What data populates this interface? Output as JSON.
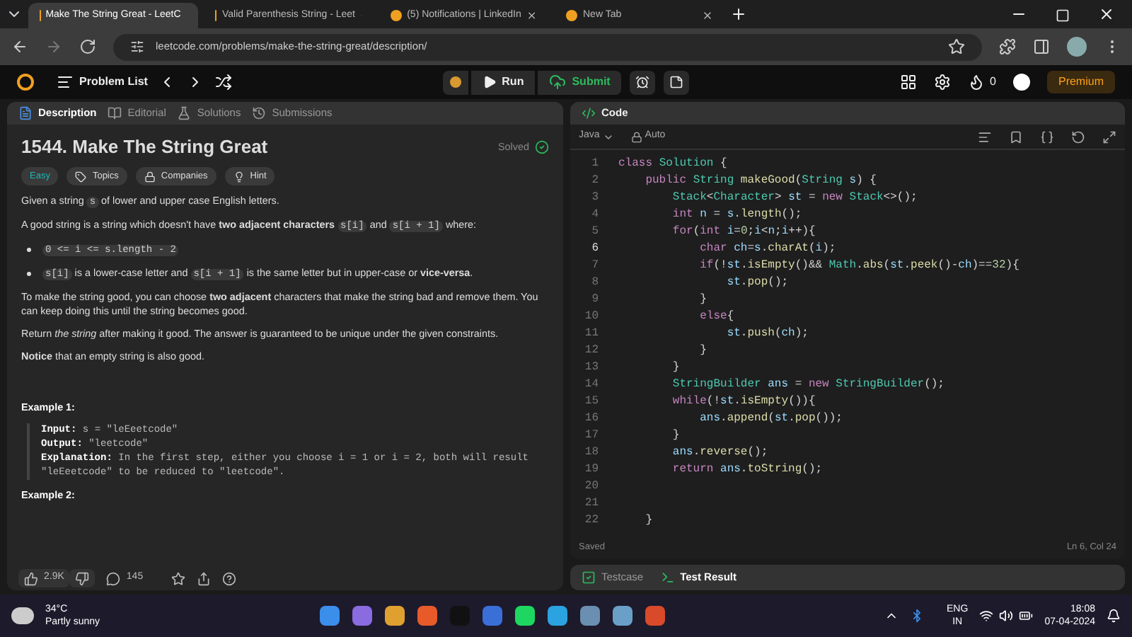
{
  "browser": {
    "tabs": [
      {
        "title": "Make The String Great - LeetC",
        "selected": true
      },
      {
        "title": "Valid Parenthesis String - Leet",
        "selected": false
      },
      {
        "title": "(5) Notifications | LinkedIn",
        "selected": false
      },
      {
        "title": "New Tab",
        "selected": false
      }
    ],
    "url": "leetcode.com/problems/make-the-string-great/description/"
  },
  "header": {
    "problem_list": "Problem List",
    "run": "Run",
    "submit": "Submit",
    "streak": "0",
    "premium": "Premium"
  },
  "left_tabs": [
    {
      "label": "Description",
      "selected": true
    },
    {
      "label": "Editorial",
      "selected": false
    },
    {
      "label": "Solutions",
      "selected": false
    },
    {
      "label": "Submissions",
      "selected": false
    }
  ],
  "problem": {
    "title": "1544. Make The String Great",
    "status": "Solved",
    "tags": [
      {
        "label": "Easy",
        "kind": "difficulty"
      },
      {
        "label": "Topics",
        "kind": "topics"
      },
      {
        "label": "Companies",
        "kind": "companies"
      },
      {
        "label": "Hint",
        "kind": "hint"
      }
    ],
    "blocks": [
      {
        "kind": "paragraph",
        "segments": [
          {
            "kind": "text",
            "text": "Given a string "
          },
          {
            "kind": "code",
            "text": "s"
          },
          {
            "kind": "text",
            "text": " of lower and upper case English letters."
          }
        ]
      },
      {
        "kind": "paragraph",
        "segments": [
          {
            "kind": "text",
            "text": "A good string is a string which doesn't have **two adjacent characters** "
          },
          {
            "kind": "code",
            "text": "s[i]"
          },
          {
            "kind": "text",
            "text": " and "
          },
          {
            "kind": "code",
            "text": "s[i + 1]"
          },
          {
            "kind": "text",
            "text": " where:"
          }
        ]
      },
      {
        "kind": "bullet",
        "segments": [
          {
            "kind": "code",
            "text": "0 <= i <= s.length - 2"
          }
        ]
      },
      {
        "kind": "bullet",
        "segments": [
          {
            "kind": "code",
            "text": "s[i]"
          },
          {
            "kind": "text",
            "text": " is a lower-case letter and "
          },
          {
            "kind": "code",
            "text": "s[i + 1]"
          },
          {
            "kind": "text",
            "text": " is the same letter but in upper-case or **vice-versa**."
          }
        ]
      },
      {
        "kind": "paragraph",
        "segments": [
          {
            "kind": "text",
            "text": "To make the string good, you can choose **two adjacent** characters that make the string bad and remove them. You can keep doing this until the string becomes good."
          }
        ]
      },
      {
        "kind": "paragraph",
        "segments": [
          {
            "kind": "text",
            "text": "Return *the string* after making it good. The answer is guaranteed to be unique under the given constraints."
          }
        ]
      },
      {
        "kind": "paragraph",
        "segments": [
          {
            "kind": "text",
            "text": "**Notice** that an empty string is also good."
          }
        ]
      },
      {
        "kind": "heading",
        "text": "Example 1:"
      },
      {
        "kind": "example",
        "lines": [
          {
            "label": "Input:",
            "text": "s = \"leEeetcode\""
          },
          {
            "label": "Output:",
            "text": "\"leetcode\""
          },
          {
            "label": "Explanation:",
            "text": "In the first step, either you choose i = 1 or i = 2, both will result \"leEeetcode\" to be reduced to \"leetcode\"."
          }
        ]
      },
      {
        "kind": "heading",
        "text": "Example 2:"
      }
    ]
  },
  "footer": {
    "likes": "2.9K",
    "comments": "145"
  },
  "code": {
    "title": "Code",
    "language": "Java",
    "mode": "Auto",
    "status": "Saved",
    "cursor": "Ln 6, Col 24",
    "lines": [
      {
        "number": "1",
        "current": false,
        "tokens": [
          {
            "kind": "kw",
            "text": "class"
          },
          {
            "kind": "type",
            "text": " Solution"
          },
          {
            "kind": "p",
            "text": " {"
          }
        ]
      },
      {
        "number": "2",
        "current": false,
        "tokens": [
          {
            "kind": "kw",
            "text": "    public"
          },
          {
            "kind": "type",
            "text": " String"
          },
          {
            "kind": "fn",
            "text": " makeGood"
          },
          {
            "kind": "p",
            "text": "("
          },
          {
            "kind": "type",
            "text": "String"
          },
          {
            "kind": "var",
            "text": " s"
          },
          {
            "kind": "p",
            "text": ") {"
          }
        ]
      },
      {
        "number": "3",
        "current": false,
        "tokens": [
          {
            "kind": "type",
            "text": "        Stack"
          },
          {
            "kind": "p",
            "text": "<"
          },
          {
            "kind": "type",
            "text": "Character"
          },
          {
            "kind": "p",
            "text": "> "
          },
          {
            "kind": "var",
            "text": "st"
          },
          {
            "kind": "p",
            "text": " = "
          },
          {
            "kind": "kw",
            "text": "new"
          },
          {
            "kind": "type",
            "text": " Stack"
          },
          {
            "kind": "p",
            "text": "<>();"
          }
        ]
      },
      {
        "number": "4",
        "current": false,
        "tokens": [
          {
            "kind": "kw",
            "text": "        int"
          },
          {
            "kind": "var",
            "text": " n"
          },
          {
            "kind": "p",
            "text": " = "
          },
          {
            "kind": "var",
            "text": "s"
          },
          {
            "kind": "p",
            "text": "."
          },
          {
            "kind": "fn",
            "text": "length"
          },
          {
            "kind": "p",
            "text": "();"
          }
        ]
      },
      {
        "number": "5",
        "current": false,
        "tokens": [
          {
            "kind": "kw",
            "text": "        for"
          },
          {
            "kind": "p",
            "text": "("
          },
          {
            "kind": "kw",
            "text": "int"
          },
          {
            "kind": "var",
            "text": " i"
          },
          {
            "kind": "p",
            "text": "="
          },
          {
            "kind": "num",
            "text": "0"
          },
          {
            "kind": "p",
            "text": ";"
          },
          {
            "kind": "var",
            "text": "i"
          },
          {
            "kind": "p",
            "text": "<"
          },
          {
            "kind": "var",
            "text": "n"
          },
          {
            "kind": "p",
            "text": ";"
          },
          {
            "kind": "var",
            "text": "i"
          },
          {
            "kind": "p",
            "text": "++){"
          }
        ]
      },
      {
        "number": "6",
        "current": true,
        "tokens": [
          {
            "kind": "kw",
            "text": "            char"
          },
          {
            "kind": "var",
            "text": " ch"
          },
          {
            "kind": "p",
            "text": "="
          },
          {
            "kind": "var",
            "text": "s"
          },
          {
            "kind": "p",
            "text": "."
          },
          {
            "kind": "fn",
            "text": "charAt"
          },
          {
            "kind": "p",
            "text": "("
          },
          {
            "kind": "var",
            "text": "i"
          },
          {
            "kind": "p",
            "text": ");"
          }
        ]
      },
      {
        "number": "7",
        "current": false,
        "tokens": [
          {
            "kind": "kw",
            "text": "            if"
          },
          {
            "kind": "p",
            "text": "(!"
          },
          {
            "kind": "var",
            "text": "st"
          },
          {
            "kind": "p",
            "text": "."
          },
          {
            "kind": "fn",
            "text": "isEmpty"
          },
          {
            "kind": "p",
            "text": "()&& "
          },
          {
            "kind": "type",
            "text": "Math"
          },
          {
            "kind": "p",
            "text": "."
          },
          {
            "kind": "fn",
            "text": "abs"
          },
          {
            "kind": "p",
            "text": "("
          },
          {
            "kind": "var",
            "text": "st"
          },
          {
            "kind": "p",
            "text": "."
          },
          {
            "kind": "fn",
            "text": "peek"
          },
          {
            "kind": "p",
            "text": "()-"
          },
          {
            "kind": "var",
            "text": "ch"
          },
          {
            "kind": "p",
            "text": ")=="
          },
          {
            "kind": "num",
            "text": "32"
          },
          {
            "kind": "p",
            "text": "){"
          }
        ]
      },
      {
        "number": "8",
        "current": false,
        "tokens": [
          {
            "kind": "var",
            "text": "                st"
          },
          {
            "kind": "p",
            "text": "."
          },
          {
            "kind": "fn",
            "text": "pop"
          },
          {
            "kind": "p",
            "text": "();"
          }
        ]
      },
      {
        "number": "9",
        "current": false,
        "tokens": [
          {
            "kind": "p",
            "text": "            }"
          }
        ]
      },
      {
        "number": "10",
        "current": false,
        "tokens": [
          {
            "kind": "kw",
            "text": "            else"
          },
          {
            "kind": "p",
            "text": "{"
          }
        ]
      },
      {
        "number": "11",
        "current": false,
        "tokens": [
          {
            "kind": "var",
            "text": "                st"
          },
          {
            "kind": "p",
            "text": "."
          },
          {
            "kind": "fn",
            "text": "push"
          },
          {
            "kind": "p",
            "text": "("
          },
          {
            "kind": "var",
            "text": "ch"
          },
          {
            "kind": "p",
            "text": ");"
          }
        ]
      },
      {
        "number": "12",
        "current": false,
        "tokens": [
          {
            "kind": "p",
            "text": "            }"
          }
        ]
      },
      {
        "number": "13",
        "current": false,
        "tokens": [
          {
            "kind": "p",
            "text": "        }"
          }
        ]
      },
      {
        "number": "14",
        "current": false,
        "tokens": [
          {
            "kind": "type",
            "text": "        StringBuilder"
          },
          {
            "kind": "var",
            "text": " ans"
          },
          {
            "kind": "p",
            "text": " = "
          },
          {
            "kind": "kw",
            "text": "new"
          },
          {
            "kind": "type",
            "text": " StringBuilder"
          },
          {
            "kind": "p",
            "text": "();"
          }
        ]
      },
      {
        "number": "15",
        "current": false,
        "tokens": [
          {
            "kind": "kw",
            "text": "        while"
          },
          {
            "kind": "p",
            "text": "(!"
          },
          {
            "kind": "var",
            "text": "st"
          },
          {
            "kind": "p",
            "text": "."
          },
          {
            "kind": "fn",
            "text": "isEmpty"
          },
          {
            "kind": "p",
            "text": "()){"
          }
        ]
      },
      {
        "number": "16",
        "current": false,
        "tokens": [
          {
            "kind": "var",
            "text": "            ans"
          },
          {
            "kind": "p",
            "text": "."
          },
          {
            "kind": "fn",
            "text": "append"
          },
          {
            "kind": "p",
            "text": "("
          },
          {
            "kind": "var",
            "text": "st"
          },
          {
            "kind": "p",
            "text": "."
          },
          {
            "kind": "fn",
            "text": "pop"
          },
          {
            "kind": "p",
            "text": "());"
          }
        ]
      },
      {
        "number": "17",
        "current": false,
        "tokens": [
          {
            "kind": "p",
            "text": "        }"
          }
        ]
      },
      {
        "number": "18",
        "current": false,
        "tokens": [
          {
            "kind": "var",
            "text": "        ans"
          },
          {
            "kind": "p",
            "text": "."
          },
          {
            "kind": "fn",
            "text": "reverse"
          },
          {
            "kind": "p",
            "text": "();"
          }
        ]
      },
      {
        "number": "19",
        "current": false,
        "tokens": [
          {
            "kind": "kw",
            "text": "        return"
          },
          {
            "kind": "var",
            "text": " ans"
          },
          {
            "kind": "p",
            "text": "."
          },
          {
            "kind": "fn",
            "text": "toString"
          },
          {
            "kind": "p",
            "text": "();"
          }
        ]
      },
      {
        "number": "20",
        "current": false
      },
      {
        "number": "21",
        "current": false
      },
      {
        "number": "22",
        "current": false,
        "tokens": [
          {
            "kind": "p",
            "text": "    }"
          }
        ]
      }
    ]
  },
  "bottom_tabs": [
    {
      "label": "Testcase",
      "selected": false
    },
    {
      "label": "Test Result",
      "selected": true
    }
  ],
  "taskbar": {
    "temperature": "34°C",
    "weather": "Partly sunny",
    "language": "ENG",
    "region": "IN",
    "time": "18:08",
    "date": "07-04-2024"
  }
}
